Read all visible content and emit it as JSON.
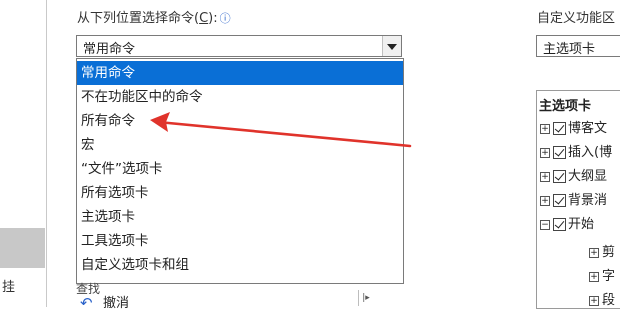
{
  "left_panel": {
    "partial_char": "挂"
  },
  "commands": {
    "label_prefix": "从下列位置选择命令(",
    "label_key": "C",
    "label_suffix": "):",
    "info_icon": "ⓘ",
    "selected": "常用命令",
    "options": [
      "常用命令",
      "不在功能区中的命令",
      "所有命令",
      "宏",
      "“文件”选项卡",
      "所有选项卡",
      "主选项卡",
      "工具选项卡",
      "自定义选项卡和组"
    ],
    "below_row_partial": "查找",
    "undo_label": "撤消",
    "submenu_arrow": "|▸"
  },
  "ribbon": {
    "label": "自定义功能区",
    "selected": "主选项卡",
    "tree_header": "主选项卡",
    "tabs": [
      {
        "expand": "⊞",
        "label": "博客文"
      },
      {
        "expand": "⊞",
        "label": "插入(博"
      },
      {
        "expand": "⊞",
        "label": "大纲显"
      },
      {
        "expand": "⊞",
        "label": "背景消"
      },
      {
        "expand": "⊟",
        "label": "开始"
      }
    ],
    "children": [
      {
        "expand": "⊞",
        "label": "剪"
      },
      {
        "expand": "⊞",
        "label": "字"
      },
      {
        "expand": "⊞",
        "label": "段"
      }
    ]
  },
  "annotation": {
    "color": "#e0332b"
  }
}
